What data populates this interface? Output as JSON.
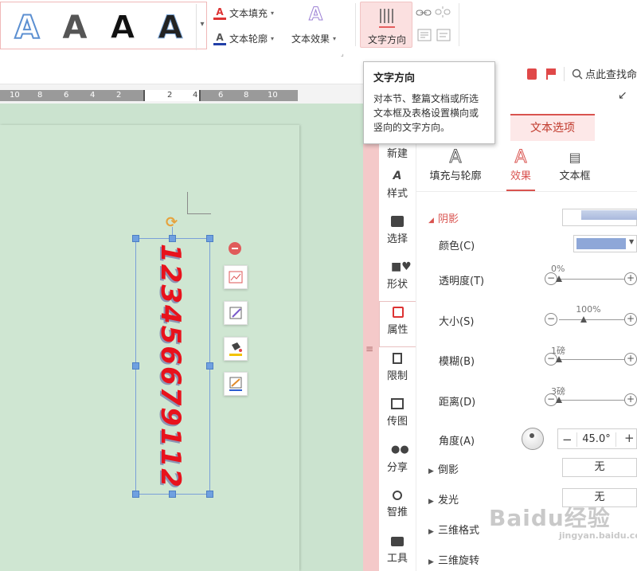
{
  "ribbon": {
    "style_gallery": {
      "items": [
        "A",
        "A",
        "A",
        "A"
      ]
    },
    "text_fill": {
      "label": "文本填充"
    },
    "text_outline": {
      "label": "文本轮廓"
    },
    "text_effect": {
      "label": "文本效果"
    },
    "text_direction": {
      "label": "文字方向"
    }
  },
  "tooltip": {
    "title": "文字方向",
    "body": "对本节、整篇文档或所选文本框及表格设置横向或竖向的文字方向。"
  },
  "toolbar_right": {
    "search": "点此查找命"
  },
  "ruler": {
    "numbers": [
      "10",
      "8",
      "6",
      "4",
      "2",
      "2",
      "4",
      "6",
      "8",
      "10"
    ]
  },
  "document": {
    "vertical_text": "123456679112"
  },
  "sidebar": {
    "items": [
      {
        "label": "新建",
        "icon": "new-icon"
      },
      {
        "label": "样式",
        "icon": "style-icon"
      },
      {
        "label": "选择",
        "icon": "select-icon"
      },
      {
        "label": "形状",
        "icon": "shape-icon"
      },
      {
        "label": "属性",
        "icon": "property-icon"
      },
      {
        "label": "限制",
        "icon": "restrict-icon"
      },
      {
        "label": "传图",
        "icon": "upload-image-icon"
      },
      {
        "label": "分享",
        "icon": "share-icon"
      },
      {
        "label": "智推",
        "icon": "smart-push-icon"
      },
      {
        "label": "工具",
        "icon": "tools-icon"
      }
    ]
  },
  "panel": {
    "tab": "文本选项",
    "subtabs": [
      "填充与轮廓",
      "效果",
      "文本框"
    ],
    "shadow_section": "阴影",
    "color": {
      "label": "颜色(C)",
      "swatch": "#8ea7d8"
    },
    "transparency": {
      "label": "透明度(T)",
      "value": "0%",
      "fraction": 0.0
    },
    "size": {
      "label": "大小(S)",
      "value": "100%",
      "fraction": 0.4
    },
    "blur": {
      "label": "模糊(B)",
      "value": "1磅",
      "fraction": 0.0
    },
    "distance": {
      "label": "距离(D)",
      "value": "3磅",
      "fraction": 0.0
    },
    "angle": {
      "label": "角度(A)",
      "value": "45.0°"
    },
    "reflection": {
      "label": "倒影",
      "value": "无"
    },
    "glow": {
      "label": "发光",
      "value": "无"
    },
    "format_3d": {
      "label": "三维格式"
    },
    "rotation_3d": {
      "label": "三维旋转"
    }
  },
  "watermark": {
    "logo": "Baidu经验",
    "url": "jingyan.baidu.com"
  },
  "colors": {
    "accent": "#d9534f",
    "page": "#cfe6d2",
    "vertical_text": "#e8121c"
  }
}
